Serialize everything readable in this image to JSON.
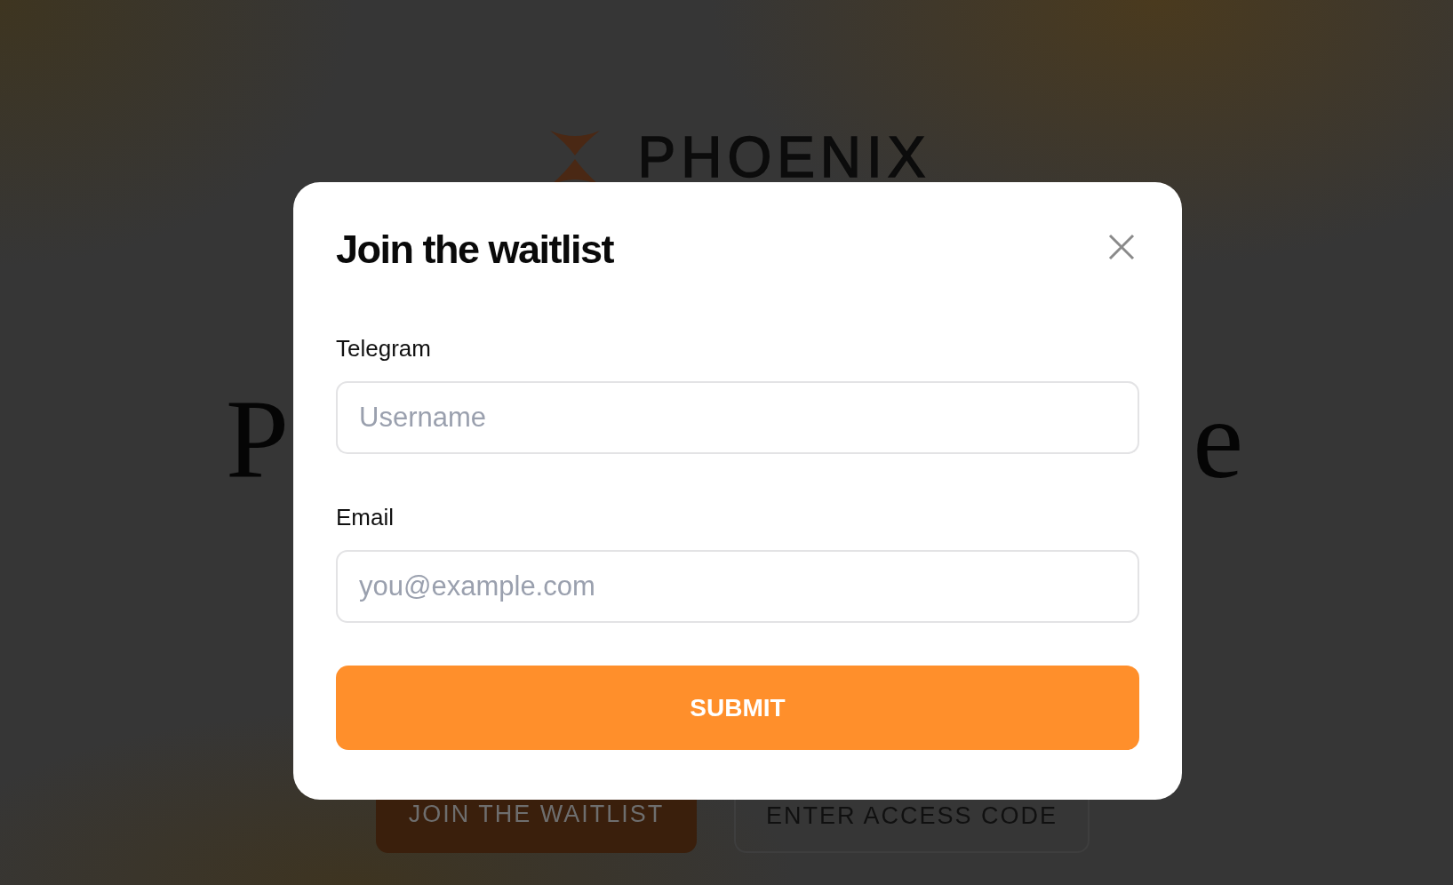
{
  "page": {
    "logo_text": "PHOENIX",
    "headline_fragments": [
      "P",
      "e"
    ],
    "buttons": [
      {
        "label": "JOIN THE WAITLIST",
        "kind": "primary"
      },
      {
        "label": "ENTER ACCESS CODE",
        "kind": "outline"
      }
    ]
  },
  "modal": {
    "title": "Join the waitlist",
    "fields": [
      {
        "label": "Telegram",
        "placeholder": "Username"
      },
      {
        "label": "Email",
        "placeholder": "you@example.com"
      }
    ],
    "submit": "SUBMIT"
  }
}
